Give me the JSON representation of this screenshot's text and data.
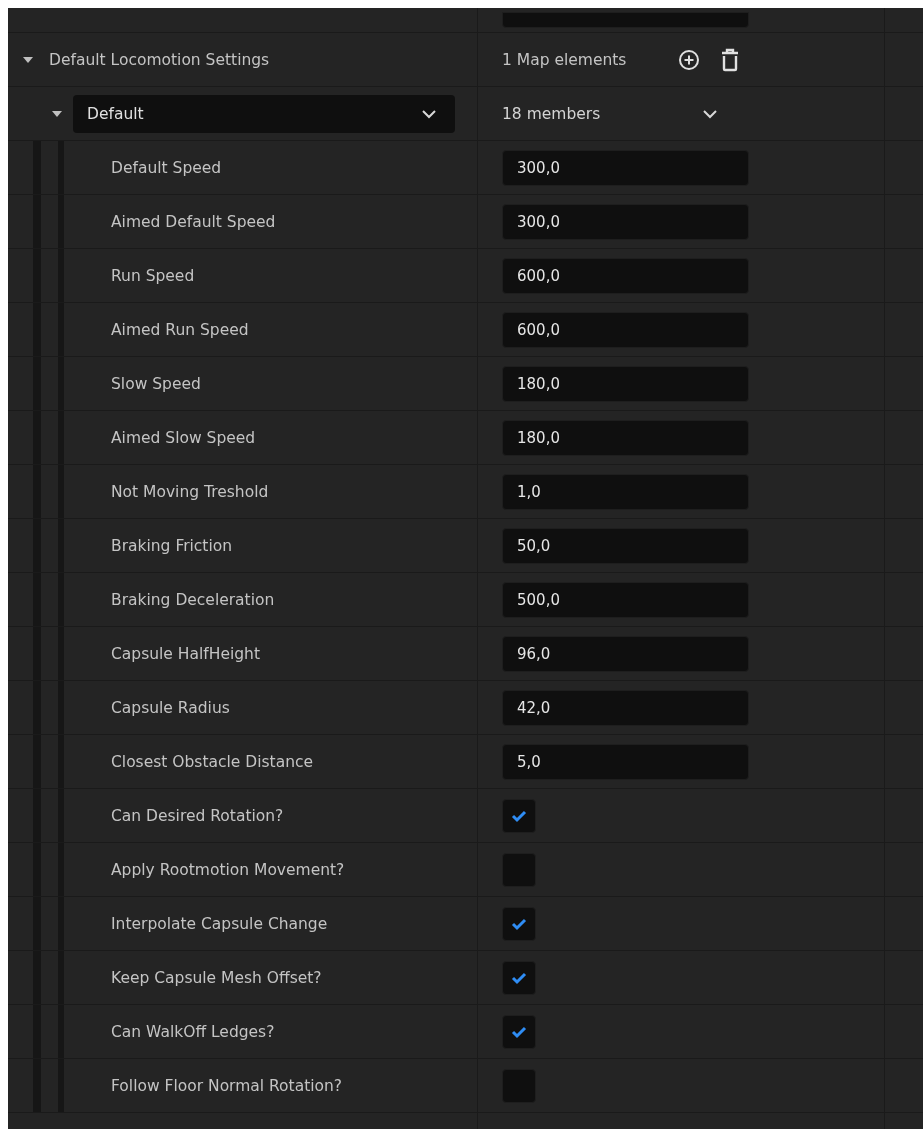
{
  "map_property": {
    "label": "Default Locomotion Settings",
    "expanded": true,
    "summary": "1 Map elements"
  },
  "element": {
    "key": "Default",
    "expanded": true,
    "summary": "18 members"
  },
  "members": [
    {
      "label": "Default Speed",
      "kind": "number",
      "value": "300,0"
    },
    {
      "label": "Aimed Default Speed",
      "kind": "number",
      "value": "300,0"
    },
    {
      "label": "Run Speed",
      "kind": "number",
      "value": "600,0"
    },
    {
      "label": "Aimed Run Speed",
      "kind": "number",
      "value": "600,0"
    },
    {
      "label": "Slow Speed",
      "kind": "number",
      "value": "180,0"
    },
    {
      "label": "Aimed Slow Speed",
      "kind": "number",
      "value": "180,0"
    },
    {
      "label": "Not Moving Treshold",
      "kind": "number",
      "value": "1,0"
    },
    {
      "label": "Braking Friction",
      "kind": "number",
      "value": "50,0"
    },
    {
      "label": "Braking Deceleration",
      "kind": "number",
      "value": "500,0"
    },
    {
      "label": "Capsule HalfHeight",
      "kind": "number",
      "value": "96,0"
    },
    {
      "label": "Capsule Radius",
      "kind": "number",
      "value": "42,0"
    },
    {
      "label": "Closest Obstacle Distance",
      "kind": "number",
      "value": "5,0"
    },
    {
      "label": "Can Desired Rotation?",
      "kind": "checkbox",
      "checked": true
    },
    {
      "label": "Apply Rootmotion Movement?",
      "kind": "checkbox",
      "checked": false
    },
    {
      "label": "Interpolate Capsule Change",
      "kind": "checkbox",
      "checked": true
    },
    {
      "label": "Keep Capsule Mesh Offset?",
      "kind": "checkbox",
      "checked": true
    },
    {
      "label": "Can WalkOff Ledges?",
      "kind": "checkbox",
      "checked": true
    },
    {
      "label": "Follow Floor Normal Rotation?",
      "kind": "checkbox",
      "checked": false
    }
  ]
}
